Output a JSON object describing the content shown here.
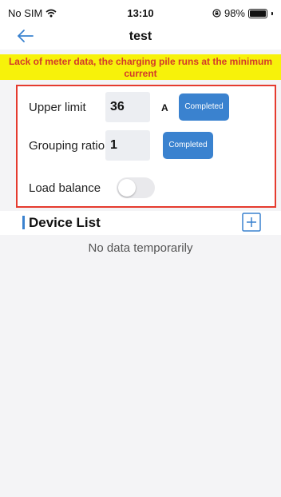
{
  "status_bar": {
    "carrier": "No SIM",
    "time": "13:10",
    "battery_percent": "98%",
    "battery_level": 0.98,
    "icons": [
      "wifi-icon",
      "orientation-lock-icon",
      "battery-icon"
    ]
  },
  "nav": {
    "title": "test",
    "back_icon": "arrow-left-icon"
  },
  "warning": {
    "text": "Lack of meter data, the charging pile runs at the minimum current"
  },
  "settings": {
    "upper_limit": {
      "label": "Upper limit",
      "value": "36",
      "unit": "A",
      "button": "Completed"
    },
    "grouping_ratio": {
      "label": "Grouping ratio",
      "value": "1",
      "button": "Completed"
    },
    "load_balance": {
      "label": "Load balance",
      "enabled": false
    }
  },
  "device_list": {
    "title": "Device List",
    "add_icon": "plus-box-icon",
    "empty_text": "No data temporarily"
  },
  "colors": {
    "accent": "#3a82cf",
    "warning_bg": "#f7f20a",
    "warning_text": "#d23a2a",
    "card_border": "#e53b2f"
  }
}
